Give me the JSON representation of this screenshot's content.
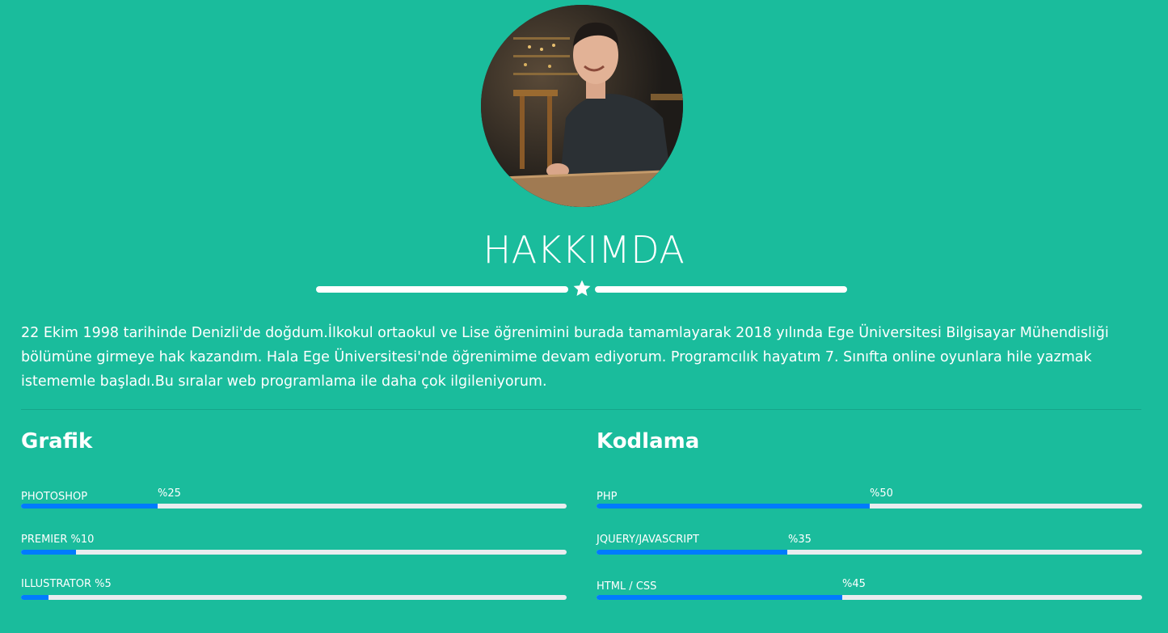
{
  "about": {
    "title": "HAKKIMDA",
    "paragraph": "22 Ekim 1998 tarihinde Denizli'de doğdum.İlkokul ortaokul ve Lise öğrenimini burada tamamlayarak 2018 yılında Ege Üniversitesi Bilgisayar Mühendisliği bölümüne girmeye hak kazandım. Hala Ege Üniversitesi'nde öğrenimime devam ediyorum. Programcılık hayatım 7. Sınıfta online oyunlara hile yazmak istememle başladı.Bu sıralar web programlama ile daha çok ilgileniyorum."
  },
  "divider_icon": "star-icon",
  "colors": {
    "background": "#1abc9c",
    "bar_fill": "#007bff",
    "bar_track": "#e9ecef",
    "text": "#ffffff"
  },
  "grafik": {
    "title": "Grafik",
    "skills": [
      {
        "label": "PHOTOSHOP",
        "pct_label": "%25",
        "value": 25
      },
      {
        "label": "PREMIER %10",
        "pct_label": "",
        "value": 10
      },
      {
        "label": "ILLUSTRATOR %5",
        "pct_label": "",
        "value": 5
      }
    ]
  },
  "kodlama": {
    "title": "Kodlama",
    "skills": [
      {
        "label": "PHP",
        "pct_label": "%50",
        "value": 50
      },
      {
        "label": "JQUERY/JAVASCRIPT",
        "pct_label": "%35",
        "value": 35
      },
      {
        "label": "HTML / CSS",
        "pct_label": "%45",
        "value": 45
      }
    ]
  }
}
